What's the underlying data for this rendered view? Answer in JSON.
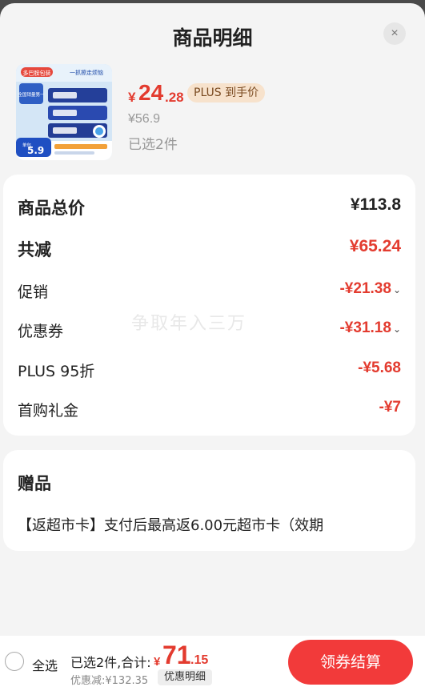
{
  "header": {
    "title": "商品明细",
    "close_glyph": "×"
  },
  "product": {
    "image": {
      "brand_tag": "多巴胺包装",
      "slogan": "一抓擦走烦恼",
      "sub_label": "全国销量第一",
      "price_tag": "5.9",
      "price_tag_label": "单包"
    },
    "price_symbol": "¥",
    "price_int": "24",
    "price_dec": ".28",
    "plus_badge": "PLUS 到手价",
    "original_price": "¥56.9",
    "selected": "已选2件"
  },
  "summary": {
    "total_label": "商品总价",
    "total_value": "¥113.8",
    "reduce_label": "共减",
    "reduce_value": "¥65.24",
    "promo_label": "促销",
    "promo_value": "-¥21.38",
    "coupon_label": "优惠券",
    "coupon_value": "-¥31.18",
    "plus_label": "PLUS 95折",
    "plus_value": "-¥5.68",
    "first_label": "首购礼金",
    "first_value": "-¥7",
    "watermark": "争取年入三万"
  },
  "gift": {
    "title": "赠品",
    "text": "【返超市卡】支付后最高返6.00元超市卡（效期"
  },
  "footer": {
    "select_all": "全选",
    "sum_label": "已选2件,合计:",
    "sum_symbol": "¥",
    "sum_int": "71",
    "sum_dec": ".15",
    "discount": "优惠减:¥132.35",
    "detail_button": "优惠明细",
    "checkout_button": "领券结算"
  },
  "colors": {
    "accent": "#e33b2f",
    "checkout": "#f23a3a",
    "plus_badge_bg": "#f7e2cc"
  },
  "icons": {
    "close": "close-icon",
    "chevron": "chevron-down-icon",
    "radio": "radio-unchecked-icon"
  }
}
